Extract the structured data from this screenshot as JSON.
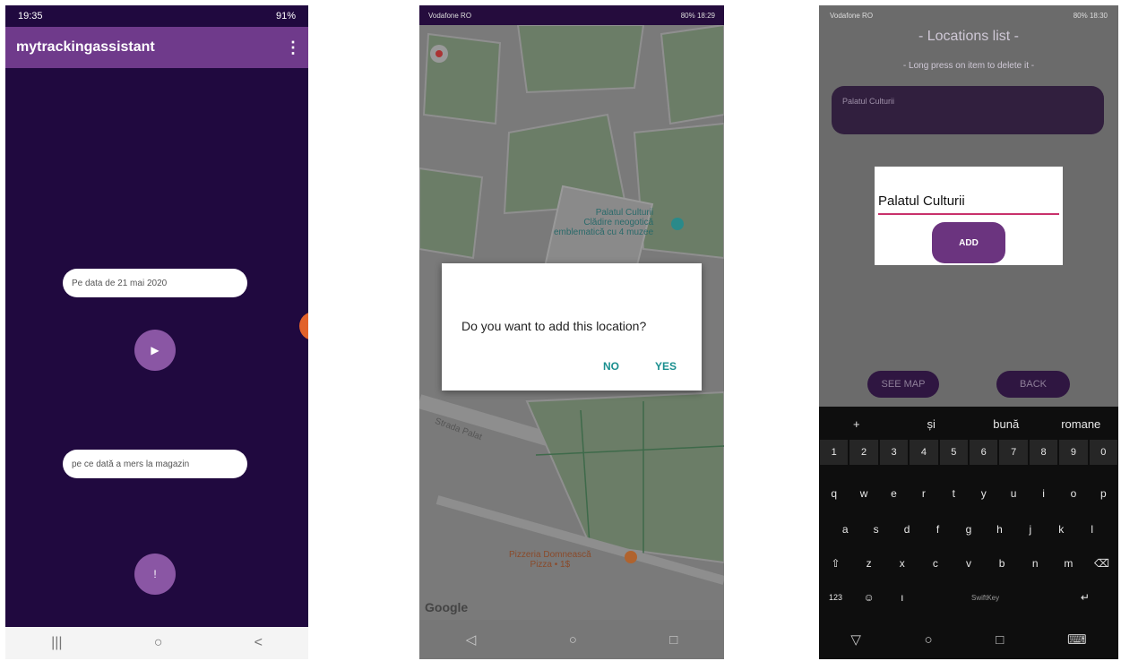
{
  "screen1": {
    "status": {
      "time": "19:35",
      "right": "91%"
    },
    "app_title": "mytrackingassistant",
    "date_input": "Pe data de 21 mai 2020",
    "play_icon": "▶",
    "query_input": "pe ce dată a mers la magazin",
    "mic_icon": "!",
    "nav": {
      "recents": "|||",
      "home": "○",
      "back": "<"
    }
  },
  "screen2": {
    "status": {
      "left": "Vodafone RO",
      "right": "80% 18:29"
    },
    "map": {
      "poi_name": "Palatul Culturii",
      "poi_desc_1": "Clădire neogotică",
      "poi_desc_2": "emblematică cu 4 muzee",
      "street": "Strada Palat",
      "restaurant_name": "Pizzeria Domnească",
      "restaurant_desc": "Pizza • 1$",
      "brand": "Google"
    },
    "dialog": {
      "message": "Do you want to add this location?",
      "no": "NO",
      "yes": "YES"
    },
    "nav": {
      "back": "◁",
      "home": "○",
      "recents": "□"
    }
  },
  "screen3": {
    "status": {
      "left": "Vodafone RO",
      "right": "80% 18:30"
    },
    "title": "- Locations list -",
    "subtitle": "- Long press on item to delete it -",
    "item": "Palatul Culturii",
    "dialog": {
      "input_value": "Palatul Culturii",
      "add": "ADD"
    },
    "see_map": "SEE MAP",
    "back": "BACK",
    "keyboard": {
      "suggestions": [
        "+",
        "și",
        "bună",
        "romane"
      ],
      "numbers": [
        "1",
        "2",
        "3",
        "4",
        "5",
        "6",
        "7",
        "8",
        "9",
        "0"
      ],
      "row1": [
        "q",
        "w",
        "e",
        "r",
        "t",
        "y",
        "u",
        "i",
        "o",
        "p"
      ],
      "row2": [
        "a",
        "s",
        "d",
        "f",
        "g",
        "h",
        "j",
        "k",
        "l"
      ],
      "row3": [
        "⇧",
        "z",
        "x",
        "c",
        "v",
        "b",
        "n",
        "m",
        "⌫"
      ],
      "row4": [
        "123",
        "☺",
        "ı",
        "SwiftKey",
        "↵"
      ]
    },
    "nav": {
      "back": "▽",
      "home": "○",
      "recents": "□",
      "keyboard": "⌨"
    }
  }
}
